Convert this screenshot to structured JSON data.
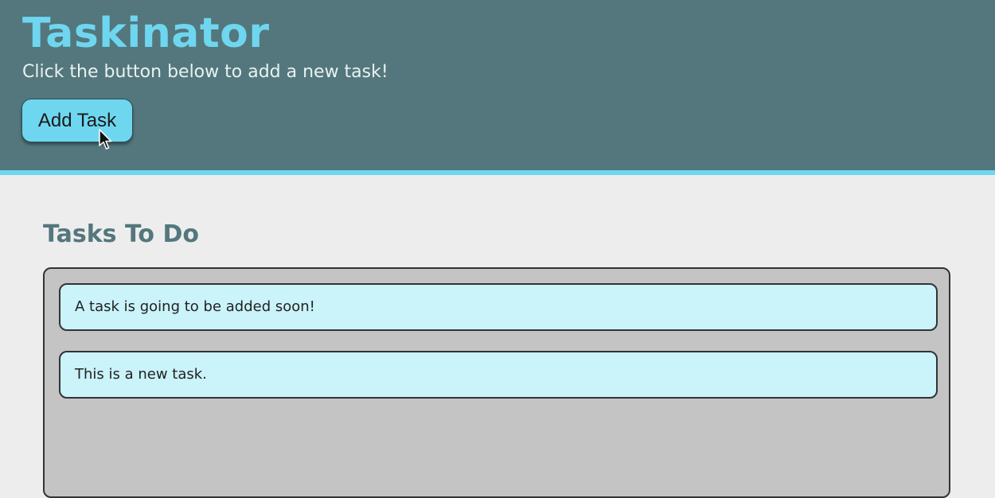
{
  "header": {
    "title": "Taskinator",
    "subtitle": "Click the button below to add a new task!",
    "add_button_label": "Add Task"
  },
  "main": {
    "section_title": "Tasks To Do",
    "tasks": [
      {
        "text": "A task is going to be added soon!"
      },
      {
        "text": "This is a new task."
      }
    ]
  },
  "colors": {
    "header_bg": "#53777c",
    "accent": "#6fd6f0",
    "task_bg": "#caf3fa",
    "list_bg": "#c4c4c4",
    "page_bg": "#ededed"
  },
  "icons": {
    "cursor": "mouse-pointer-icon"
  }
}
